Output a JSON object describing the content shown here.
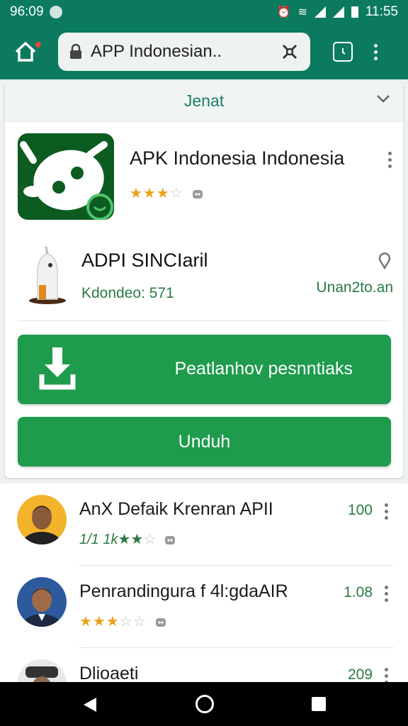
{
  "status_bar": {
    "left_time": "96:09",
    "right_time": "11:55"
  },
  "url_bar": {
    "text": "APP Indonesian.."
  },
  "section": {
    "title": "Jenat"
  },
  "app": {
    "name": "APK Indonesia Indonesia",
    "rating_stars": "★★★",
    "rating_empty": "☆"
  },
  "developer": {
    "name": "ADPI SINCIaril",
    "sub": "Kdondeo: 571",
    "meta": "Unan2to.an"
  },
  "buttons": {
    "primary_label": "Peatlanhov pesnntiaks",
    "secondary_label": "Unduh"
  },
  "list": [
    {
      "title": "AnX Defaik Krenran APII",
      "rating_text": "1/1 1k★★",
      "rating_empty": "☆",
      "count": "100",
      "avatar_bg": "#f3b32a"
    },
    {
      "title": "Penrandingura f 4l:gdaAIR",
      "rating_stars": "★★★",
      "rating_empty": "☆☆",
      "count": "1.08",
      "avatar_bg": "#2c5a9c"
    },
    {
      "title": "Dlioaeti",
      "count": "209",
      "avatar_bg": "#e8e8e8"
    }
  ],
  "colors": {
    "brand": "#0b7a5f",
    "button": "#1e9b4d",
    "star": "#eaa21a",
    "accent_text": "#2b7a43"
  }
}
